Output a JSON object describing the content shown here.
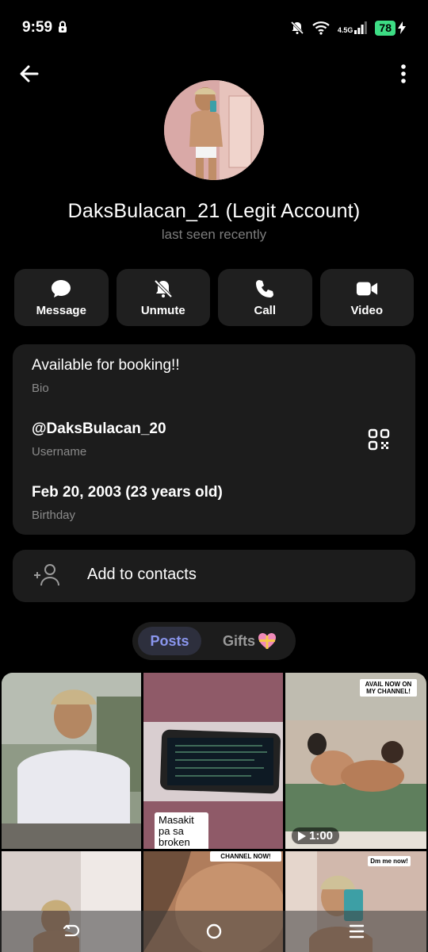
{
  "status_bar": {
    "time": "9:59",
    "network": "4.5G",
    "battery": "78"
  },
  "profile": {
    "name": "DaksBulacan_21 (Legit Account)",
    "status": "last seen recently"
  },
  "actions": [
    {
      "label": "Message",
      "icon": "chat-bubble-icon"
    },
    {
      "label": "Unmute",
      "icon": "bell-off-icon"
    },
    {
      "label": "Call",
      "icon": "phone-icon"
    },
    {
      "label": "Video",
      "icon": "video-camera-icon"
    }
  ],
  "info": {
    "bio": {
      "value": "Available for booking!!",
      "label": "Bio"
    },
    "username": {
      "value": "@DaksBulacan_20",
      "label": "Username"
    },
    "birthday": {
      "value": "Feb 20, 2003 (23 years old)",
      "label": "Birthday"
    }
  },
  "add_contact": {
    "label": "Add to contacts"
  },
  "tabs": {
    "posts": "Posts",
    "gifts": "Gifts"
  },
  "grid": {
    "tile2_caption": "Masakit pa sa broken hearted",
    "tile3_overlay": "AVAIL NOW ON MY CHANNEL!",
    "tile3_duration": "1:00",
    "tile5_overlay": "CHANNEL NOW!",
    "tile6_overlay": "Dm me now!"
  },
  "colors": {
    "accent": "#8a96ee",
    "card": "#1c1c1c",
    "battery": "#3ddc84"
  }
}
